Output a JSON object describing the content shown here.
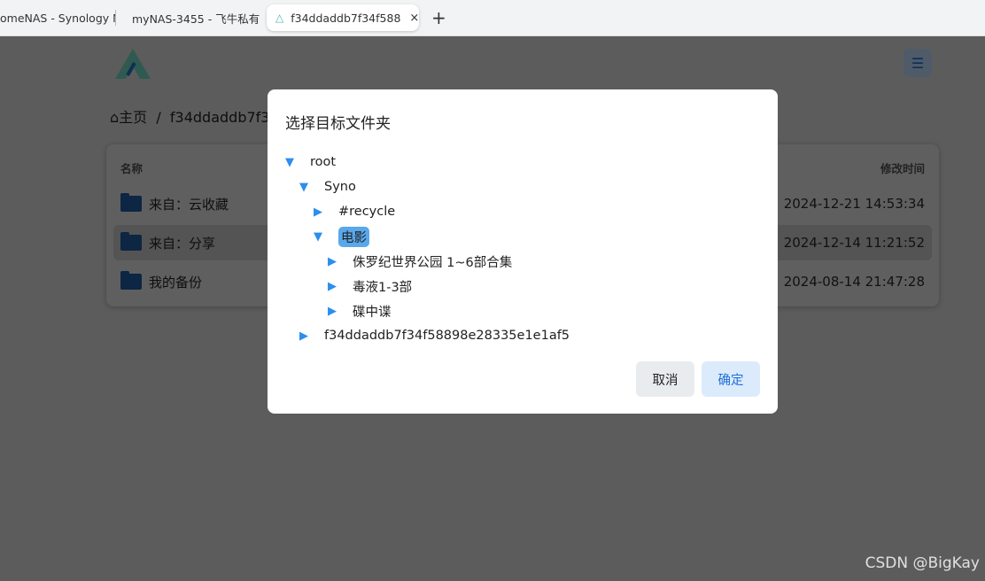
{
  "browser": {
    "tabs": [
      {
        "label": "omeNAS - Synology N"
      },
      {
        "label": "myNAS-3455 - 飞牛私有"
      },
      {
        "label": "f34ddaddb7f34f588",
        "active": true
      }
    ],
    "new_tab": "+",
    "close": "×"
  },
  "page": {
    "breadcrumb": {
      "home": "主页",
      "sep": "/",
      "current": "f34ddaddb7f3"
    },
    "table": {
      "col_name": "名称",
      "col_time": "修改时间",
      "rows": [
        {
          "name": "来自：云收藏",
          "time": "2024-12-21 14:53:34"
        },
        {
          "name": "来自：分享",
          "time": "2024-12-14 11:21:52",
          "selected": true
        },
        {
          "name": "我的备份",
          "time": "2024-08-14 21:47:28"
        }
      ]
    }
  },
  "dialog": {
    "title": "选择目标文件夹",
    "tree": [
      {
        "label": "root",
        "level": 0,
        "expanded": true
      },
      {
        "label": "Syno",
        "level": 1,
        "expanded": true
      },
      {
        "label": "#recycle",
        "level": 2,
        "expanded": false
      },
      {
        "label": "电影",
        "level": 2,
        "expanded": true,
        "selected": true
      },
      {
        "label": "侏罗纪世界公园 1~6部合集",
        "level": 3,
        "expanded": false
      },
      {
        "label": "毒液1-3部",
        "level": 3,
        "expanded": false
      },
      {
        "label": "碟中谍",
        "level": 3,
        "expanded": false
      },
      {
        "label": "f34ddaddb7f34f58898e28335e1e1af5",
        "level": 1,
        "expanded": false
      }
    ],
    "cancel": "取消",
    "ok": "确定"
  },
  "watermark": "CSDN @BigKay",
  "colors": {
    "accent": "#2b8ef0",
    "selected": "#5aa8ec"
  }
}
